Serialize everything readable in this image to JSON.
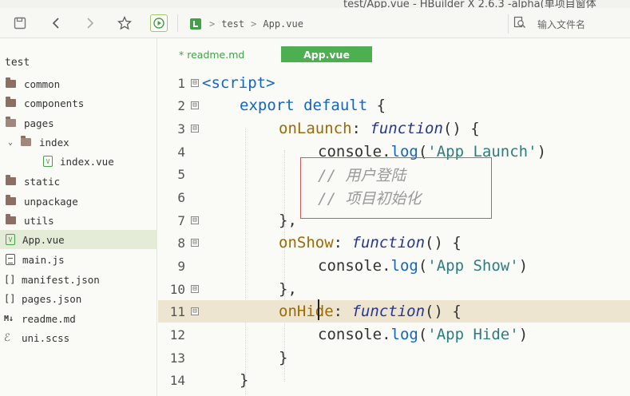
{
  "window": {
    "title": "test/App.vue - HBuilder X 2.6.3 -alpha(单项目窗体"
  },
  "breadcrumb": {
    "project": "test",
    "file": "App.vue",
    "separator": ">"
  },
  "search": {
    "placeholder": "输入文件名"
  },
  "sidebar": {
    "project": "test",
    "items": [
      {
        "label": "common",
        "type": "folder"
      },
      {
        "label": "components",
        "type": "folder"
      },
      {
        "label": "pages",
        "type": "folder"
      },
      {
        "label": "index",
        "type": "folder-open",
        "chevron": "⌄"
      },
      {
        "label": "index.vue",
        "type": "vue"
      },
      {
        "label": "static",
        "type": "folder"
      },
      {
        "label": "unpackage",
        "type": "folder"
      },
      {
        "label": "utils",
        "type": "folder"
      },
      {
        "label": "App.vue",
        "type": "vue"
      },
      {
        "label": "main.js",
        "type": "js"
      },
      {
        "label": "manifest.json",
        "type": "json",
        "icon": "[]"
      },
      {
        "label": "pages.json",
        "type": "json",
        "icon": "[]"
      },
      {
        "label": "readme.md",
        "type": "md",
        "icon": "M↓"
      },
      {
        "label": "uni.scss",
        "type": "scss",
        "icon": "ℰ"
      }
    ]
  },
  "tabs": [
    {
      "label": "* readme.md",
      "active": false
    },
    {
      "label": "App.vue",
      "active": true
    }
  ],
  "code": {
    "line_numbers": [
      "1",
      "2",
      "3",
      "4",
      "5",
      "6",
      "7",
      "8",
      "9",
      "10",
      "11",
      "12",
      "13",
      "14"
    ],
    "l1": {
      "tag": "<script>"
    },
    "l2": {
      "kw": "export default",
      "rest": " {"
    },
    "l3": {
      "name": "onLaunch",
      "colon": ": ",
      "fx": "function",
      "rest": "() {"
    },
    "l4": {
      "obj": "console.",
      "fn": "log",
      "open": "(",
      "str": "'App Launch'",
      "close": ")"
    },
    "l5": {
      "comment": "// 用户登陆"
    },
    "l6": {
      "comment": "// 项目初始化"
    },
    "l7": {
      "text": "},"
    },
    "l8": {
      "name": "onShow",
      "colon": ": ",
      "fx": "function",
      "rest": "() {"
    },
    "l9": {
      "obj": "console.",
      "fn": "log",
      "open": "(",
      "str": "'App Show'",
      "close": ")"
    },
    "l10": {
      "text": "},"
    },
    "l11": {
      "name": "onHide",
      "colon": ": ",
      "fx": "function",
      "rest": "() {"
    },
    "l12": {
      "obj": "console.",
      "fn": "log",
      "open": "(",
      "str": "'App Hide'",
      "close": ")"
    },
    "l13": {
      "text": "}"
    },
    "l14": {
      "text": "}"
    }
  },
  "fold_marker": "⊟",
  "colors": {
    "accent": "#4caf50",
    "keyword": "#1565c0",
    "annotation": "#e05050"
  }
}
